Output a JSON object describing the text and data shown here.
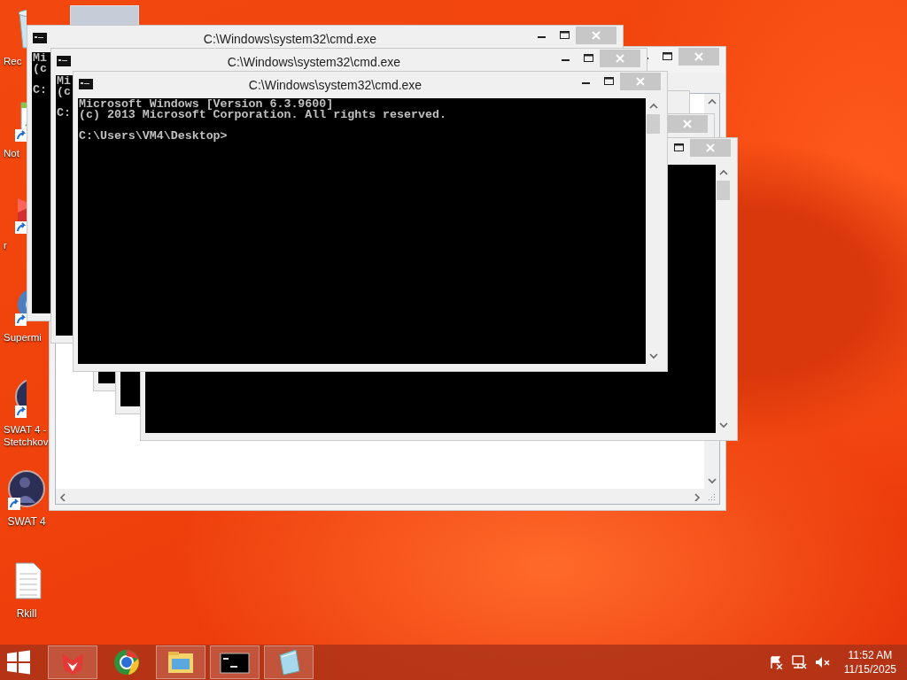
{
  "desktop": {
    "icons": [
      {
        "kind": "recycle",
        "label": "Rec",
        "cut": true,
        "shortcut": false
      },
      {
        "kind": "notepad",
        "label": "Not",
        "cut": true,
        "shortcut": true
      },
      {
        "kind": "red-app",
        "label": "r",
        "cut": true,
        "shortcut": true
      },
      {
        "kind": "browser",
        "label": "Supermi",
        "cut": true,
        "shortcut": true
      },
      {
        "kind": "game",
        "label": "SWAT 4 - Stetchkov",
        "cut": true,
        "shortcut": true
      },
      {
        "kind": "game",
        "label": "SWAT 4",
        "cut": false,
        "shortcut": true
      },
      {
        "kind": "document",
        "label": "Rkill",
        "cut": false,
        "shortcut": false
      }
    ]
  },
  "windows": [
    {
      "kind": "editor",
      "buttons": [
        {
          "kind": "minimize"
        },
        {
          "kind": "maximize"
        },
        {
          "kind": "close"
        }
      ]
    },
    {
      "kind": "cmd",
      "title": "C:\\Windows\\system32\\cmd.exe",
      "buttons": [
        {
          "kind": "minimize"
        },
        {
          "kind": "maximize"
        },
        {
          "kind": "close"
        }
      ],
      "lines": [
        "Mi",
        "(c"
      ],
      "prompt": "C:"
    },
    {
      "kind": "cmd",
      "title": "C:\\Windows\\system32\\cmd.exe",
      "buttons": [
        {
          "kind": "minimize"
        },
        {
          "kind": "maximize"
        },
        {
          "kind": "close"
        }
      ],
      "lines": [
        "Mi",
        "(c"
      ],
      "prompt": "C:"
    },
    {
      "kind": "cmd"
    },
    {
      "kind": "cmd",
      "buttons": [
        {
          "kind": "close"
        }
      ]
    },
    {
      "kind": "cmd",
      "buttons": [
        {
          "kind": "maximize"
        },
        {
          "kind": "close"
        }
      ],
      "scrollbar": true
    },
    {
      "kind": "cmd",
      "title": "C:\\Windows\\system32\\cmd.exe",
      "buttons": [
        {
          "kind": "minimize"
        },
        {
          "kind": "maximize"
        },
        {
          "kind": "close"
        }
      ],
      "scrollbar": true,
      "lines": [
        "Microsoft Windows [Version 6.3.9600]",
        "(c) 2013 Microsoft Corporation. All rights reserved."
      ],
      "prompt": "C:\\Users\\VM4\\Desktop>"
    }
  ],
  "taskbar": {
    "items": [
      {
        "kind": "fox",
        "open": true
      },
      {
        "kind": "browser",
        "open": false
      },
      {
        "kind": "explorer",
        "open": true
      },
      {
        "kind": "cmd",
        "open": true
      },
      {
        "kind": "notepad",
        "open": true
      }
    ],
    "time": "11:52 AM",
    "date": "11/15/2025"
  }
}
